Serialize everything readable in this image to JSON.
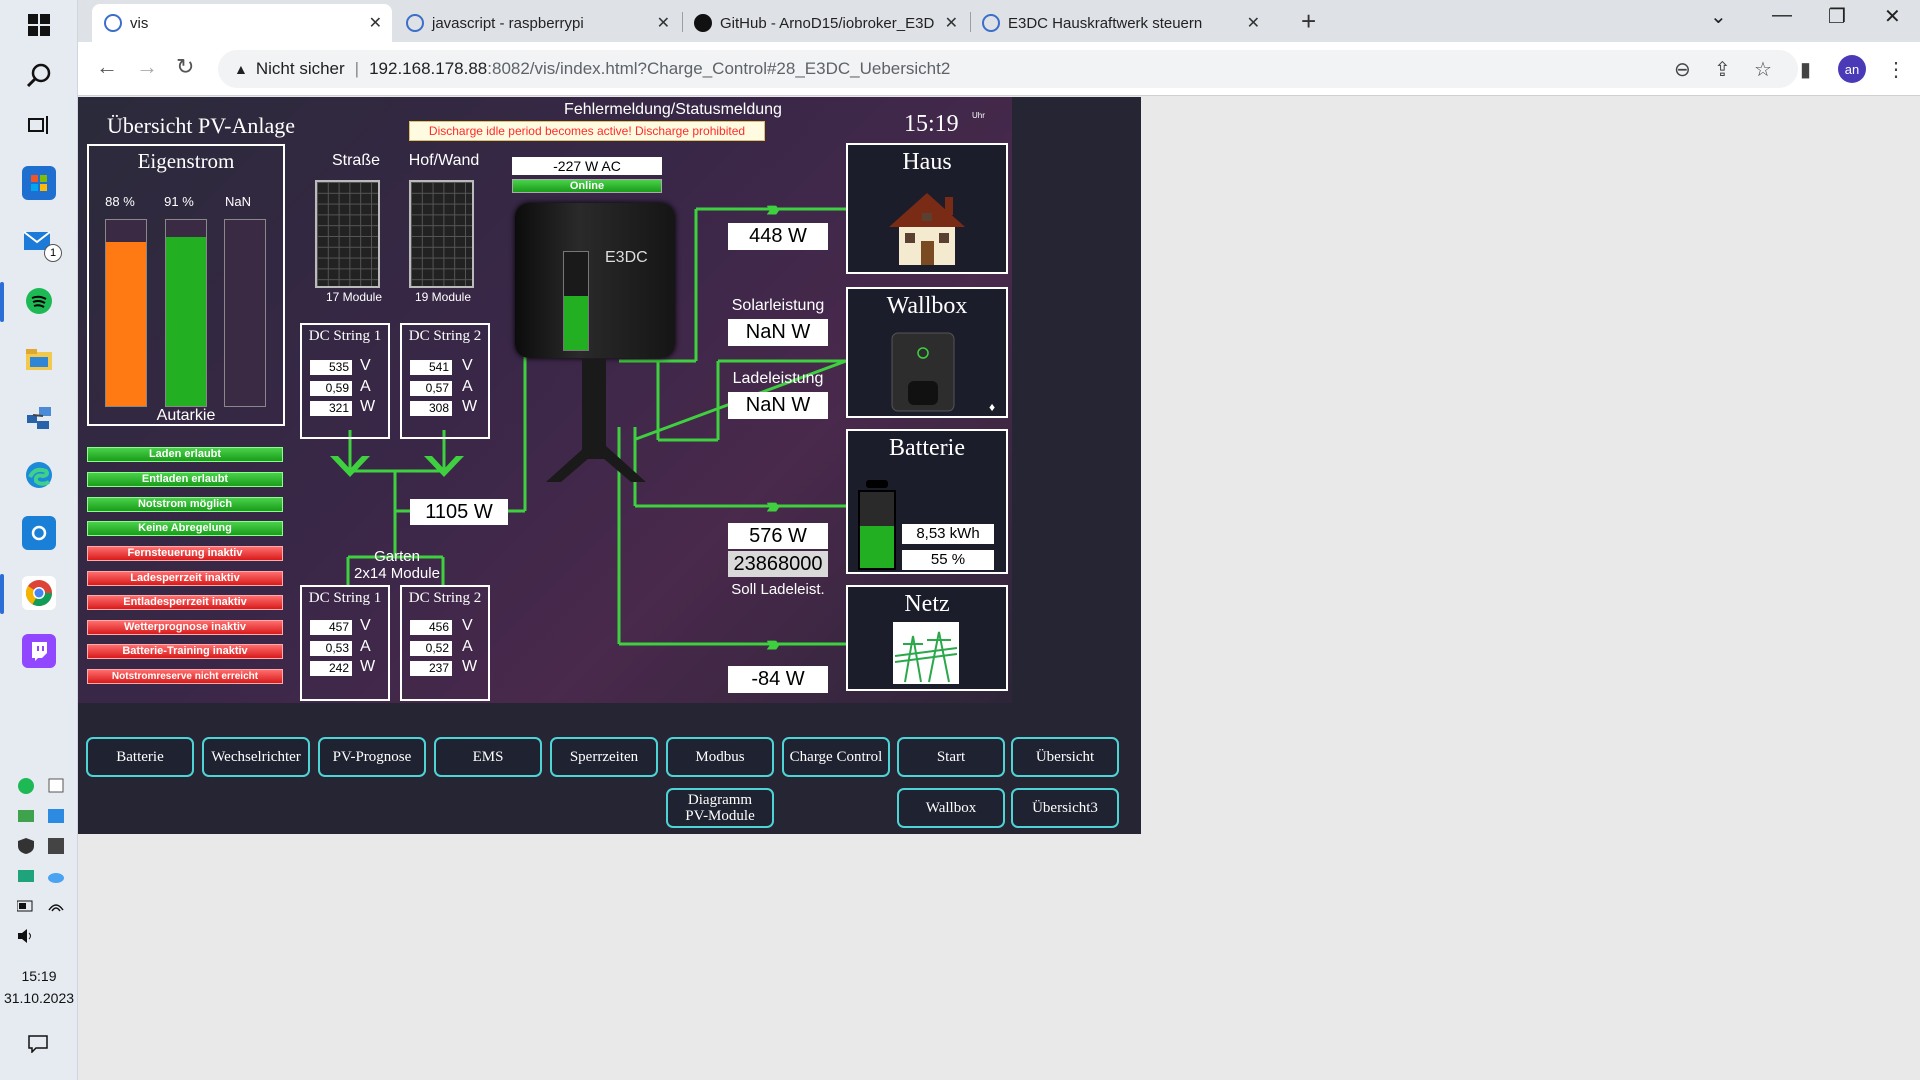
{
  "browser": {
    "tabs": [
      {
        "title": "vis",
        "active": true
      },
      {
        "title": "javascript - raspberrypi",
        "active": false
      },
      {
        "title": "GitHub - ArnoD15/iobroker_E3D",
        "active": false
      },
      {
        "title": "E3DC Hauskraftwerk steuern",
        "active": false
      }
    ],
    "security_label": "Nicht sicher",
    "url_host": "192.168.178.88",
    "url_path": ":8082/vis/index.html?Charge_Control#28_E3DC_Uebersicht2",
    "profile_initials": "an"
  },
  "taskbar": {
    "time": "15:19",
    "date": "31.10.2023",
    "mail_badge": "1"
  },
  "header": {
    "title": "Übersicht PV-Anlage",
    "status_title": "Fehlermeldung/Statusmeldung",
    "status_message": "Discharge idle period becomes active! Discharge prohibited",
    "clock": "15:19",
    "clock_unit": "Uhr"
  },
  "eigenstrom": {
    "title": "Eigenstrom",
    "bars": [
      {
        "label": "88 %",
        "level": 0.88,
        "color": "#ff7a12"
      },
      {
        "label": "91 %",
        "level": 0.91,
        "color": "#22b022"
      },
      {
        "label": "NaN %",
        "level": 0,
        "color": "#555"
      }
    ],
    "footer": "Autarkie"
  },
  "status_flags": [
    {
      "label": "Laden erlaubt",
      "state": "ok"
    },
    {
      "label": "Entladen erlaubt",
      "state": "ok"
    },
    {
      "label": "Notstrom möglich",
      "state": "ok"
    },
    {
      "label": "Keine Abregelung",
      "state": "ok"
    },
    {
      "label": "Fernsteuerung inaktiv",
      "state": "off"
    },
    {
      "label": "Ladesperrzeit inaktiv",
      "state": "off"
    },
    {
      "label": "Entladesperrzeit inaktiv",
      "state": "off"
    },
    {
      "label": "Wetterprognose inaktiv",
      "state": "off"
    },
    {
      "label": "Batterie-Training inaktiv",
      "state": "off"
    },
    {
      "label": "Notstromreserve nicht erreicht",
      "state": "off"
    }
  ],
  "pv": {
    "panel1_title": "Straße",
    "panel1_modules": "17 Module",
    "panel2_title": "Hof/Wand",
    "panel2_modules": "19 Module",
    "string1": {
      "title": "DC String 1",
      "v": "535",
      "a": "0,59",
      "w": "321"
    },
    "string2": {
      "title": "DC String 2",
      "v": "541",
      "a": "0,57",
      "w": "308"
    },
    "total": "1105 W",
    "garden_title": "Garten",
    "garden_modules": "2x14 Module",
    "string3": {
      "title": "DC String 1",
      "v": "457",
      "a": "0,53",
      "w": "242"
    },
    "string4": {
      "title": "DC String 2",
      "v": "456",
      "a": "0,52",
      "w": "237"
    },
    "units": {
      "v": "V",
      "a": "A",
      "w": "W"
    }
  },
  "inverter": {
    "ac_power": "-227 W AC",
    "state": "Online",
    "brand": "E3DC",
    "fill_level": 0.55
  },
  "house": {
    "title": "Haus",
    "power": "448 W"
  },
  "wallbox": {
    "title": "Wallbox",
    "solar_label": "Solarleistung",
    "solar_value": "NaN W",
    "charge_label": "Ladeleistung",
    "charge_value": "NaN W"
  },
  "battery": {
    "title": "Batterie",
    "power": "576 W",
    "soll_value": "23868000",
    "soll_label": "Soll Ladeleist.",
    "energy": "8,53 kWh",
    "soc": "55 %",
    "soc_level": 0.55
  },
  "grid": {
    "title": "Netz",
    "power": "-84 W"
  },
  "nav_row1": [
    "Batterie",
    "Wechselrichter",
    "PV-Prognose",
    "EMS",
    "Sperrzeiten",
    "Modbus",
    "Charge Control",
    "Start",
    "Übersicht"
  ],
  "nav_row2": {
    "diagram": "Diagramm\nPV-Module",
    "wallbox": "Wallbox",
    "overview3": "Übersicht3"
  },
  "colors": {
    "flow": "#3fd03f",
    "accent_cyan": "#4fd4d6",
    "panel_bg": "#3a2748"
  }
}
